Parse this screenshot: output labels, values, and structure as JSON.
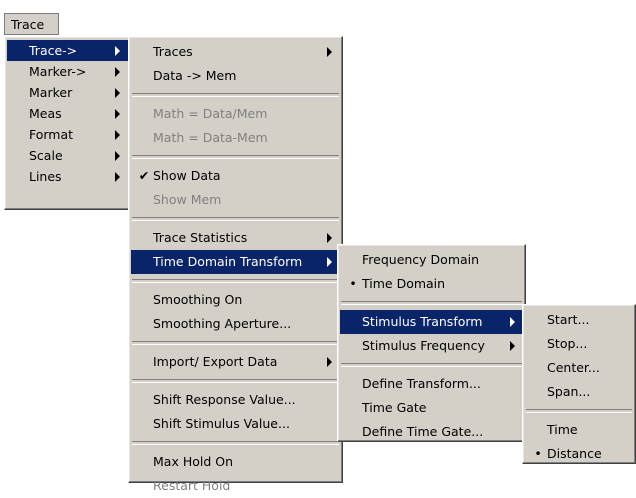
{
  "menubar": {
    "trace_label": "Trace"
  },
  "menu1": {
    "items": [
      "Trace->",
      "Marker->",
      "Marker",
      "Meas",
      "Format",
      "Scale",
      "Lines"
    ]
  },
  "menu2": {
    "traces": "Traces",
    "data_to_mem": "Data -> Mem",
    "math_div": "Math = Data/Mem",
    "math_sub": "Math = Data-Mem",
    "show_data": "Show Data",
    "show_mem": "Show Mem",
    "trace_statistics": "Trace Statistics",
    "time_domain_transform": "Time Domain Transform",
    "smoothing_on": "Smoothing On",
    "smoothing_aperture": "Smoothing Aperture...",
    "import_export": "Import/ Export Data",
    "shift_response": "Shift Response Value...",
    "shift_stimulus": "Shift Stimulus Value...",
    "max_hold_on": "Max Hold On",
    "restart_hold": "Restart Hold",
    "check_mark": "✔"
  },
  "menu3": {
    "frequency_domain": "Frequency Domain",
    "time_domain": "Time Domain",
    "stimulus_transform": "Stimulus Transform",
    "stimulus_frequency": "Stimulus Frequency",
    "define_transform": "Define Transform...",
    "time_gate": "Time Gate",
    "define_time_gate": "Define Time Gate...",
    "bullet": "•"
  },
  "menu4": {
    "start": "Start...",
    "stop": "Stop...",
    "center": "Center...",
    "span": "Span...",
    "time": "Time",
    "distance": "Distance",
    "bullet": "•"
  }
}
